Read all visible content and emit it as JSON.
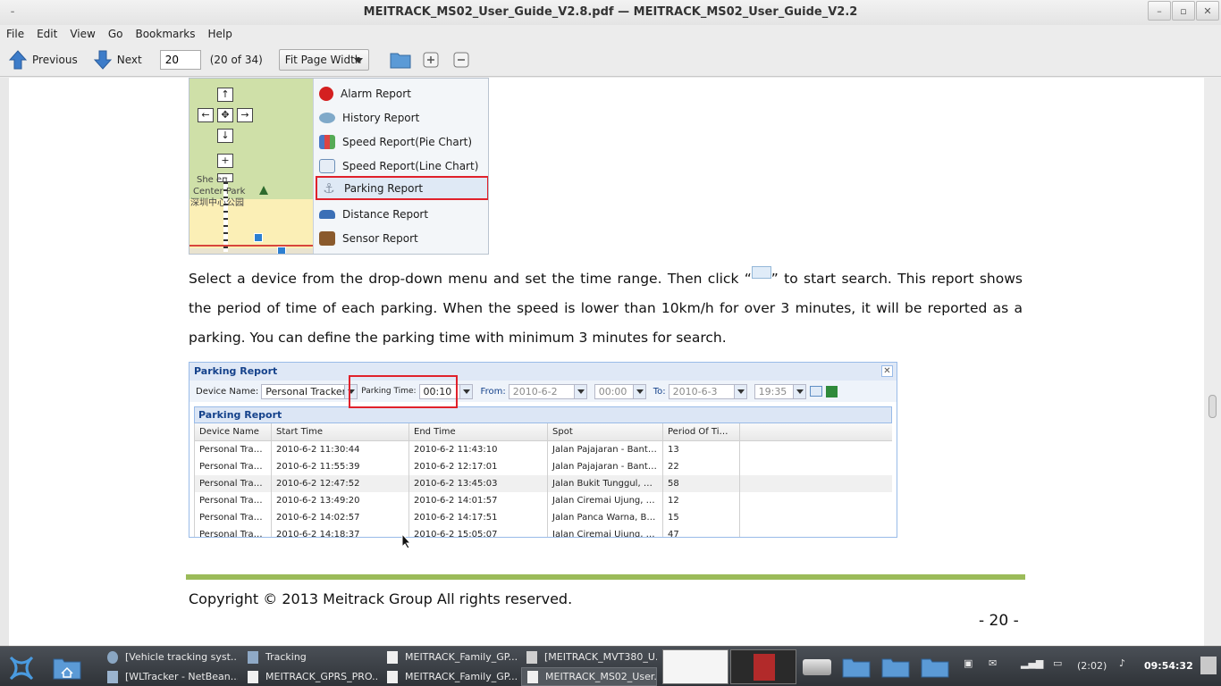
{
  "window": {
    "title": "MEITRACK_MS02_User_Guide_V2.8.pdf — MEITRACK_MS02_User_Guide_V2.2",
    "buttons": [
      "minimize",
      "maximize",
      "close"
    ]
  },
  "menubar": {
    "items": [
      "File",
      "Edit",
      "View",
      "Go",
      "Bookmarks",
      "Help"
    ]
  },
  "toolbar": {
    "previous_label": "Previous",
    "next_label": "Next",
    "page_value": "20",
    "page_count": "(20 of 34)",
    "zoom_value": "Fit Page Width"
  },
  "document": {
    "context_menu": {
      "items": [
        {
          "label": "Alarm Report",
          "icon": "alarm-icon",
          "color": "#d42020"
        },
        {
          "label": "History Report",
          "icon": "history-icon",
          "color": "#7fa9c9"
        },
        {
          "label": "Speed Report(Pie Chart)",
          "icon": "bar-chart-icon",
          "color": "#4a78c4"
        },
        {
          "label": "Speed Report(Line Chart)",
          "icon": "line-chart-icon",
          "color": "#6b8fb8"
        },
        {
          "label": "Parking Report",
          "icon": "anchor-icon",
          "color": "#8a97a8",
          "selected": true
        },
        {
          "label": "Distance Report",
          "icon": "car-icon",
          "color": "#3b6fb6"
        },
        {
          "label": "Sensor Report",
          "icon": "sensor-icon",
          "color": "#8a5a2c"
        }
      ]
    },
    "map": {
      "label_line1": "She  en",
      "label_line2": "Center Park",
      "label_line3": "深圳中心公园"
    },
    "paragraph": {
      "part1": "Select a device from the drop-down menu and set the time range. Then click “",
      "part2": "” to start search. This report shows the period of time of each parking. When the speed is lower than 10km/h for over 3 minutes, it will be reported as a parking. You can define the parking time with minimum 3 minutes for search."
    },
    "report": {
      "title": "Parking Report",
      "device_label": "Device Name:",
      "device_value": "Personal Tracker",
      "parking_label": "Parking Time:",
      "parking_value": "00:10",
      "from_label": "From:",
      "from_date": "2010-6-2",
      "from_time": "00:00",
      "to_label": "To:",
      "to_date": "2010-6-3",
      "to_time": "19:35",
      "subtitle": "Parking Report",
      "columns": [
        "Device Name",
        "Start Time",
        "End Time",
        "Spot",
        "Period Of Time(..."
      ],
      "rows": [
        [
          "Personal Tracker",
          "2010-6-2 11:30:44",
          "2010-6-2 11:43:10",
          "Jalan Pajajaran - Bantarjati...",
          "13"
        ],
        [
          "Personal Tracker",
          "2010-6-2 11:55:39",
          "2010-6-2 12:17:01",
          "Jalan Pajajaran - Bantarjati...",
          "22"
        ],
        [
          "Personal Tracker",
          "2010-6-2 12:47:52",
          "2010-6-2 13:45:03",
          "Jalan Bukit Tunggul, Bogor...",
          "58"
        ],
        [
          "Personal Tracker",
          "2010-6-2 13:49:20",
          "2010-6-2 14:01:57",
          "Jalan Ciremai Ujung, Bogor...",
          "12"
        ],
        [
          "Personal Tracker",
          "2010-6-2 14:02:57",
          "2010-6-2 14:17:51",
          "Jalan Panca Warna, Bogor...",
          "15"
        ],
        [
          "Personal Tracker",
          "2010-6-2 14:18:37",
          "2010-6-2 15:05:07",
          "Jalan Ciremai Ujung, Bogor...",
          "47"
        ]
      ]
    },
    "copyright": "Copyright © 2013 Meitrack Group All rights reserved.",
    "page_number": "- 20 -"
  },
  "taskbar": {
    "tasks": [
      {
        "label": "[Vehicle tracking syst...",
        "icon": "browser-icon"
      },
      {
        "label": "Tracking",
        "icon": "folder-icon"
      },
      {
        "label": "MEITRACK_Family_GP...",
        "icon": "document-icon"
      },
      {
        "label": "[MEITRACK_MVT380_U...",
        "icon": "document-icon"
      },
      {
        "label": "[WLTracker - NetBean...",
        "icon": "netbeans-icon"
      },
      {
        "label": "MEITRACK_GPRS_PRO...",
        "icon": "document-icon"
      },
      {
        "label": "MEITRACK_Family_GP...",
        "icon": "document-icon"
      },
      {
        "label": "MEITRACK_MS02_User...",
        "icon": "document-icon",
        "active": true
      }
    ],
    "battery": "(2:02)",
    "clock": "09:54:32"
  }
}
